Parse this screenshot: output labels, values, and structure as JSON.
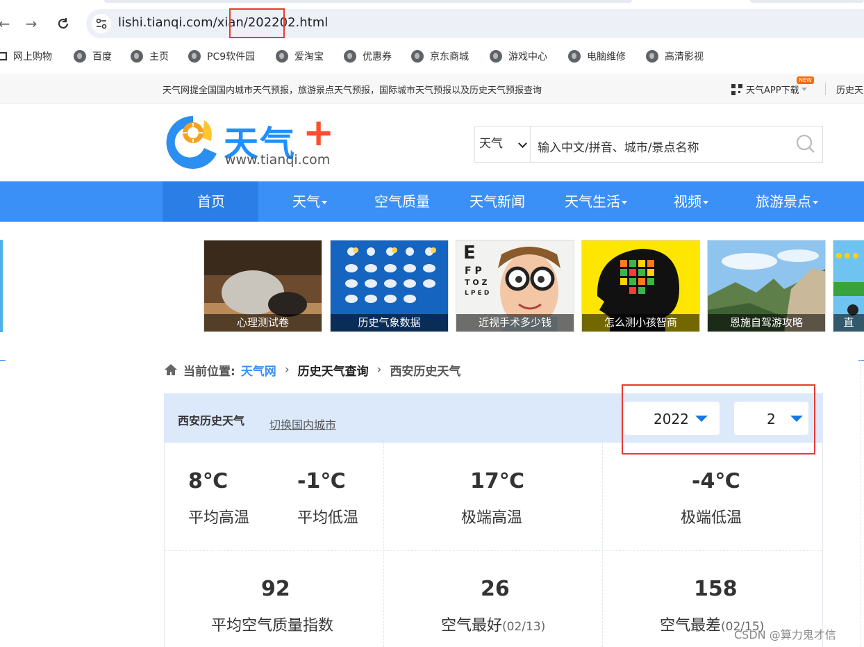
{
  "browser": {
    "url": "lishi.tianqi.com/xian/202202.html",
    "bookmarks": [
      "网上购物",
      "百度",
      "主页",
      "PC9软件园",
      "爱淘宝",
      "优惠券",
      "京东商城",
      "游戏中心",
      "电脑维修",
      "高清影视"
    ]
  },
  "topbar": {
    "description": "天气网提全国国内城市天气预报，旅游景点天气预报，国际城市天气预报以及历史天气预报查询",
    "app_download": "天气APP下载",
    "new_badge": "NEW",
    "history_link": "历史天"
  },
  "logo": {
    "name": "天气",
    "plus": "+",
    "domain": "www.tianqi.com"
  },
  "search": {
    "type_selected": "天气",
    "placeholder": "输入中文/拼音、城市/景点名称"
  },
  "nav": {
    "items": [
      "首页",
      "天气",
      "空气质量",
      "天气新闻",
      "天气生活",
      "视频",
      "旅游景点"
    ]
  },
  "banners": [
    "心理测试卷",
    "历史气象数据",
    "近视手术多少钱",
    "怎么测小孩智商",
    "恩施自驾游攻略",
    "直"
  ],
  "breadcrumb": {
    "label": "当前位置:",
    "items": [
      "天气网",
      "历史天气查询",
      "西安历史天气"
    ]
  },
  "panel": {
    "title": "西安历史天气",
    "switch_city": "切换国内城市",
    "year": "2022",
    "month": "2"
  },
  "stats": {
    "avg_high": {
      "value": "8℃",
      "label": "平均高温"
    },
    "avg_low": {
      "value": "-1℃",
      "label": "平均低温"
    },
    "extreme_high": {
      "value": "17℃",
      "label": "极端高温"
    },
    "extreme_low": {
      "value": "-4℃",
      "label": "极端低温"
    },
    "avg_aqi": {
      "value": "92",
      "label": "平均空气质量指数"
    },
    "best_air": {
      "value": "26",
      "label": "空气最好",
      "date": "(02/13)"
    },
    "worst_air": {
      "value": "158",
      "label": "空气最差",
      "date": "(02/15)"
    }
  },
  "watermark": "CSDN @算力鬼才信",
  "colors": {
    "nav_blue": "#3b90f7",
    "nav_active": "#2b7ee6",
    "panel_head": "#dce9fb",
    "highlight_red": "#e53a30",
    "select_arrow": "#1677e8"
  }
}
